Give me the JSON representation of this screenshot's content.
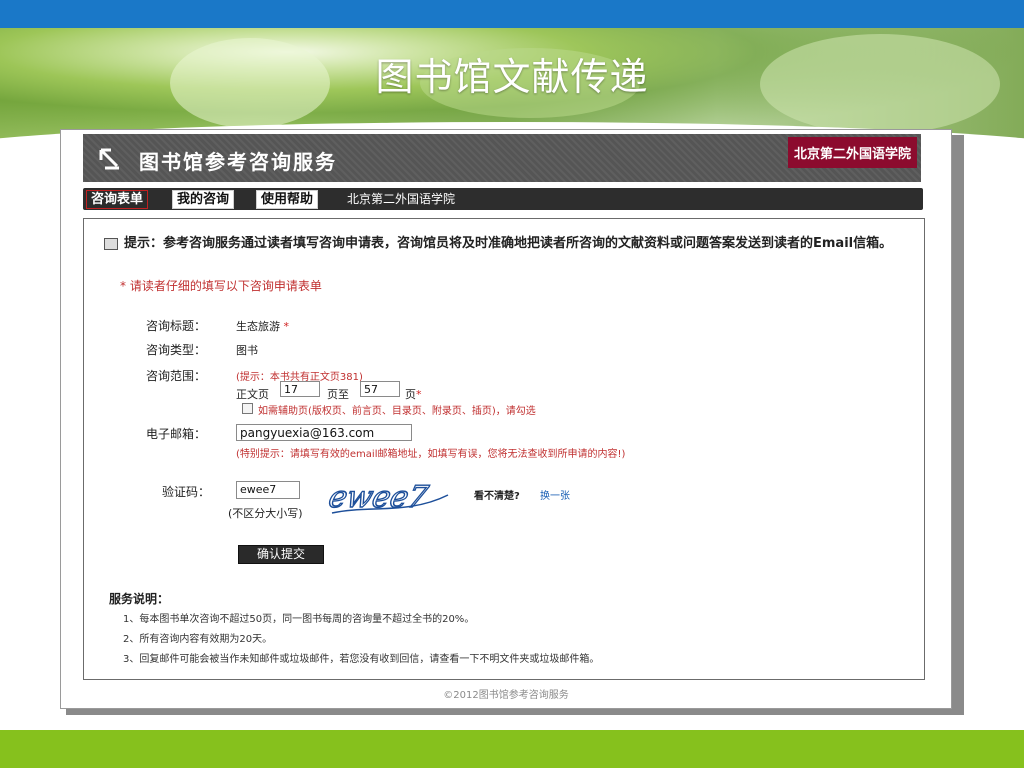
{
  "slide": {
    "title": "图书馆文献传递"
  },
  "header": {
    "system_title": "图书馆参考咨询服务",
    "school": "北京第二外国语学院"
  },
  "tabs": [
    {
      "label": "咨询表单",
      "active": true
    },
    {
      "label": "我的咨询",
      "active": false
    },
    {
      "label": "使用帮助",
      "active": false
    }
  ],
  "tab_extra": "北京第二外国语学院",
  "notice": "提示：参考咨询服务通过读者填写咨询申请表，咨询馆员将及时准确地把读者所咨询的文献资料或问题答案发送到读者的Email信箱。",
  "instruction": "* 请读者仔细的填写以下咨询申请表单",
  "form": {
    "title_label": "咨询标题：",
    "title_value": "生态旅游",
    "required_mark": "*",
    "type_label": "咨询类型：",
    "type_value": "图书",
    "range_label": "咨询范围：",
    "range_tip": "(提示：本书共有正文页381)",
    "range_from_label": "正文页",
    "range_from": "17",
    "range_to_label": "页至",
    "range_to": "57",
    "range_unit": "页",
    "aux_checkbox_label": "如需辅助页(版权页、前言页、目录页、附录页、插页)，请勾选",
    "email_label": "电子邮箱：",
    "email_value": "pangyuexia@163.com",
    "email_tip": "(特别提示：请填写有效的email邮箱地址，如填写有误，您将无法查收到所申请的内容!)",
    "captcha_label": "验证码：",
    "captcha_value": "ewee7",
    "captcha_image_text": "ewee7",
    "captcha_note": "(不区分大小写)",
    "unclear": "看不清楚?",
    "refresh": "换一张",
    "submit": "确认提交"
  },
  "service": {
    "title": "服务说明：",
    "items": [
      "1、每本图书单次咨询不超过50页，同一图书每周的咨询量不超过全书的20%。",
      "2、所有咨询内容有效期为20天。",
      "3、回复邮件可能会被当作未知邮件或垃圾邮件，若您没有收到回信，请查看一下不明文件夹或垃圾邮件箱。"
    ]
  },
  "footer": "©2012图书馆参考咨询服务",
  "colors": {
    "top_band": "#1a78c8",
    "bottom_band": "#86c11d",
    "school_badge": "#8c0b2e",
    "tip_red": "#c03030"
  },
  "icons": [
    "return-arrow-icon",
    "notice-icon",
    "checkbox"
  ]
}
